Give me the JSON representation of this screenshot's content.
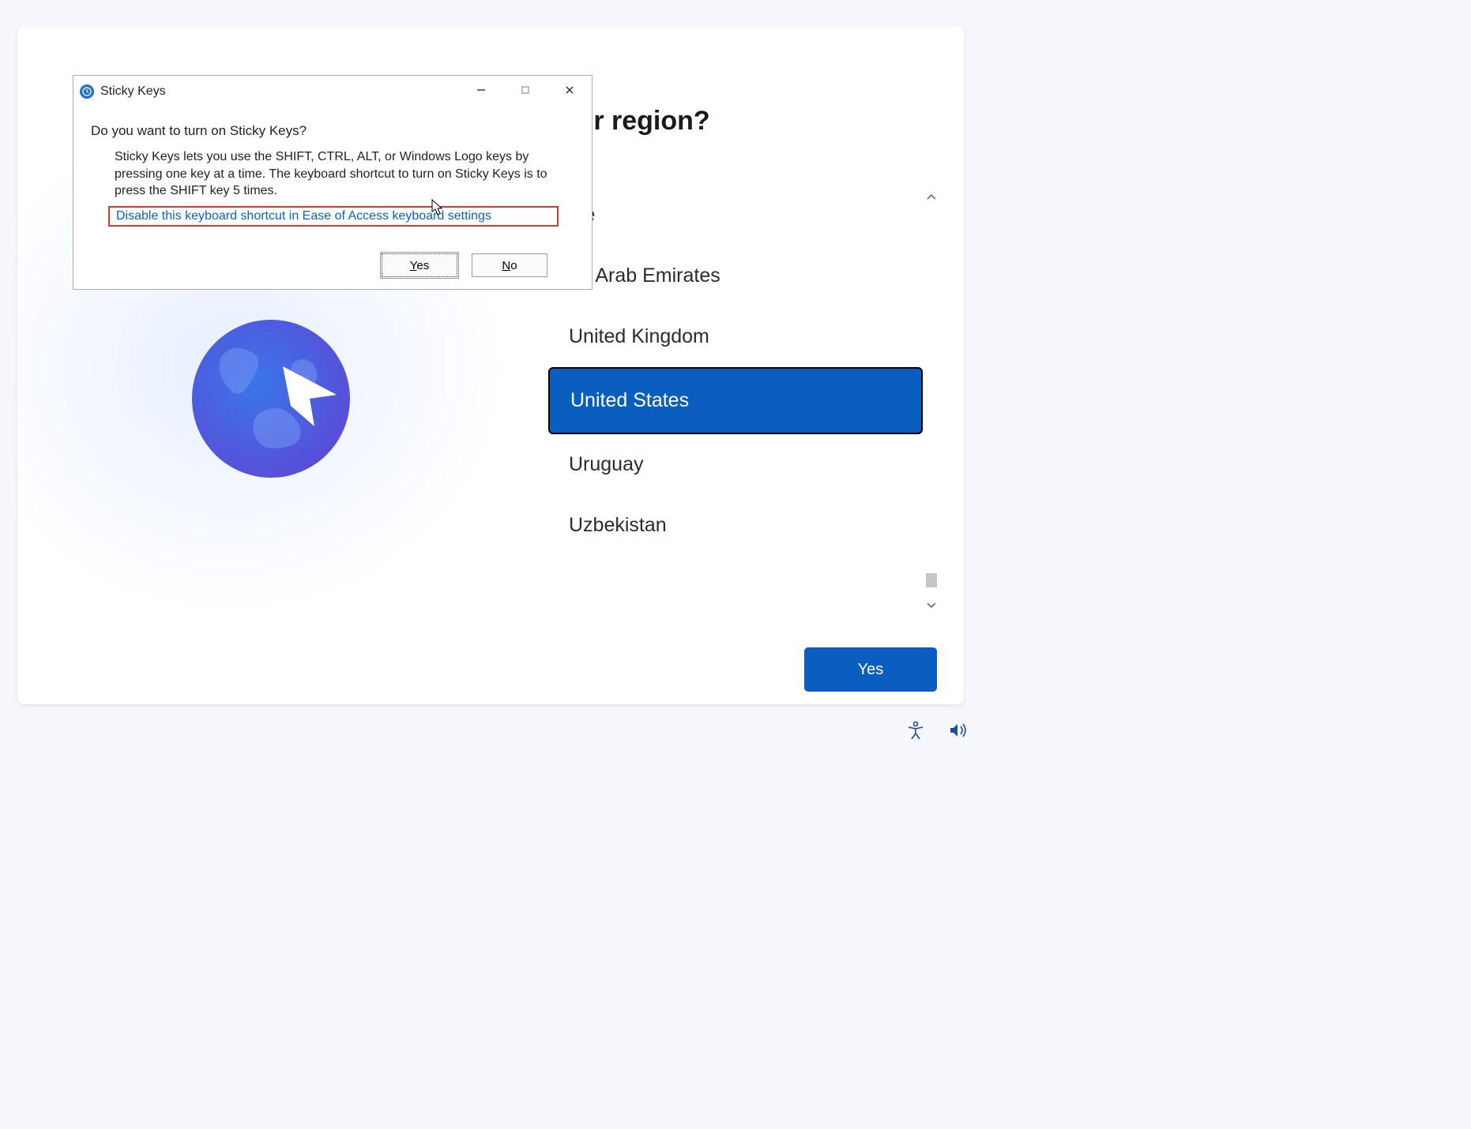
{
  "oobe": {
    "heading": "Is this the right country or region?",
    "countries": [
      {
        "label": "Ukraine",
        "partial": "ine"
      },
      {
        "label": "United Arab Emirates",
        "partial": "ed Arab Emirates"
      },
      {
        "label": "United Kingdom",
        "partial": "United Kingdom"
      },
      {
        "label": "United States",
        "partial": "United States",
        "selected": true
      },
      {
        "label": "Uruguay",
        "partial": "Uruguay"
      },
      {
        "label": "Uzbekistan",
        "partial": "Uzbekistan"
      }
    ],
    "confirm_label": "Yes"
  },
  "dialog": {
    "title": "Sticky Keys",
    "question": "Do you want to turn on Sticky Keys?",
    "body": "Sticky Keys lets you use the SHIFT, CTRL, ALT, or Windows Logo keys by pressing one key at a time. The keyboard shortcut to turn on Sticky Keys is to press the SHIFT key 5 times.",
    "link": "Disable this keyboard shortcut in Ease of Access keyboard settings",
    "yes": "Yes",
    "no": "No"
  },
  "tray": {
    "accessibility": "accessibility-icon",
    "volume": "volume-icon"
  }
}
